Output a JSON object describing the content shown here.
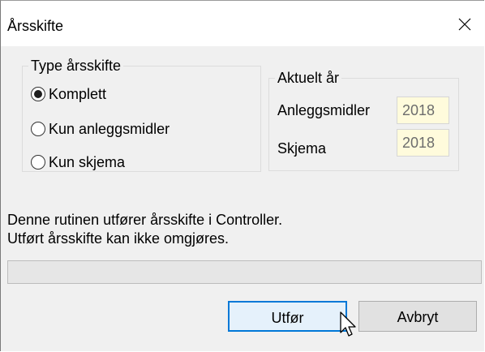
{
  "window": {
    "title": "Årsskifte",
    "close_icon": "close-icon"
  },
  "type_group": {
    "legend": "Type årsskifte",
    "options": [
      {
        "label": "Komplett",
        "checked": true
      },
      {
        "label": "Kun anleggsmidler",
        "checked": false
      },
      {
        "label": "Kun skjema",
        "checked": false
      }
    ]
  },
  "year_group": {
    "legend": "Aktuelt år",
    "fields": [
      {
        "label": "Anleggsmidler",
        "value": "2018"
      },
      {
        "label": "Skjema",
        "value": "2018"
      }
    ]
  },
  "description": {
    "line1": "Denne rutinen utfører årsskifte i Controller.",
    "line2": "Utført årsskifte kan ikke omgjøres."
  },
  "progress": {
    "fraction": 0
  },
  "buttons": {
    "execute_label": "Utfør",
    "cancel_label": "Avbryt"
  },
  "colors": {
    "dialog_bg": "#f0f0f0",
    "titlebar_bg": "#ffffff",
    "year_field_bg": "#fffbdc",
    "primary_border": "#0078d7",
    "primary_bg": "#e5f1fb"
  }
}
